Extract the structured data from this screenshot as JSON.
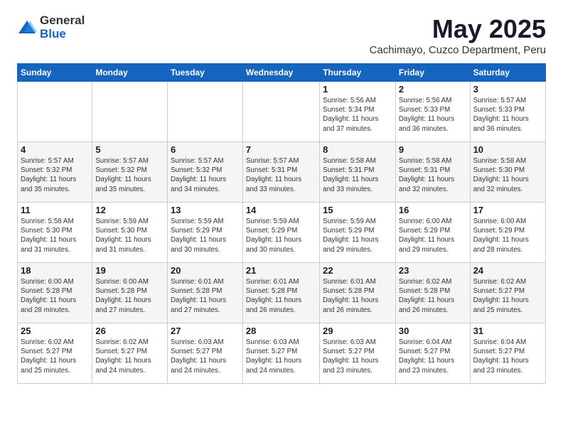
{
  "logo": {
    "general": "General",
    "blue": "Blue"
  },
  "title": "May 2025",
  "subtitle": "Cachimayo, Cuzco Department, Peru",
  "days_of_week": [
    "Sunday",
    "Monday",
    "Tuesday",
    "Wednesday",
    "Thursday",
    "Friday",
    "Saturday"
  ],
  "weeks": [
    [
      {
        "day": "",
        "info": ""
      },
      {
        "day": "",
        "info": ""
      },
      {
        "day": "",
        "info": ""
      },
      {
        "day": "",
        "info": ""
      },
      {
        "day": "1",
        "info": "Sunrise: 5:56 AM\nSunset: 5:34 PM\nDaylight: 11 hours\nand 37 minutes."
      },
      {
        "day": "2",
        "info": "Sunrise: 5:56 AM\nSunset: 5:33 PM\nDaylight: 11 hours\nand 36 minutes."
      },
      {
        "day": "3",
        "info": "Sunrise: 5:57 AM\nSunset: 5:33 PM\nDaylight: 11 hours\nand 36 minutes."
      }
    ],
    [
      {
        "day": "4",
        "info": "Sunrise: 5:57 AM\nSunset: 5:32 PM\nDaylight: 11 hours\nand 35 minutes."
      },
      {
        "day": "5",
        "info": "Sunrise: 5:57 AM\nSunset: 5:32 PM\nDaylight: 11 hours\nand 35 minutes."
      },
      {
        "day": "6",
        "info": "Sunrise: 5:57 AM\nSunset: 5:32 PM\nDaylight: 11 hours\nand 34 minutes."
      },
      {
        "day": "7",
        "info": "Sunrise: 5:57 AM\nSunset: 5:31 PM\nDaylight: 11 hours\nand 33 minutes."
      },
      {
        "day": "8",
        "info": "Sunrise: 5:58 AM\nSunset: 5:31 PM\nDaylight: 11 hours\nand 33 minutes."
      },
      {
        "day": "9",
        "info": "Sunrise: 5:58 AM\nSunset: 5:31 PM\nDaylight: 11 hours\nand 32 minutes."
      },
      {
        "day": "10",
        "info": "Sunrise: 5:58 AM\nSunset: 5:30 PM\nDaylight: 11 hours\nand 32 minutes."
      }
    ],
    [
      {
        "day": "11",
        "info": "Sunrise: 5:58 AM\nSunset: 5:30 PM\nDaylight: 11 hours\nand 31 minutes."
      },
      {
        "day": "12",
        "info": "Sunrise: 5:59 AM\nSunset: 5:30 PM\nDaylight: 11 hours\nand 31 minutes."
      },
      {
        "day": "13",
        "info": "Sunrise: 5:59 AM\nSunset: 5:29 PM\nDaylight: 11 hours\nand 30 minutes."
      },
      {
        "day": "14",
        "info": "Sunrise: 5:59 AM\nSunset: 5:29 PM\nDaylight: 11 hours\nand 30 minutes."
      },
      {
        "day": "15",
        "info": "Sunrise: 5:59 AM\nSunset: 5:29 PM\nDaylight: 11 hours\nand 29 minutes."
      },
      {
        "day": "16",
        "info": "Sunrise: 6:00 AM\nSunset: 5:29 PM\nDaylight: 11 hours\nand 29 minutes."
      },
      {
        "day": "17",
        "info": "Sunrise: 6:00 AM\nSunset: 5:29 PM\nDaylight: 11 hours\nand 28 minutes."
      }
    ],
    [
      {
        "day": "18",
        "info": "Sunrise: 6:00 AM\nSunset: 5:28 PM\nDaylight: 11 hours\nand 28 minutes."
      },
      {
        "day": "19",
        "info": "Sunrise: 6:00 AM\nSunset: 5:28 PM\nDaylight: 11 hours\nand 27 minutes."
      },
      {
        "day": "20",
        "info": "Sunrise: 6:01 AM\nSunset: 5:28 PM\nDaylight: 11 hours\nand 27 minutes."
      },
      {
        "day": "21",
        "info": "Sunrise: 6:01 AM\nSunset: 5:28 PM\nDaylight: 11 hours\nand 26 minutes."
      },
      {
        "day": "22",
        "info": "Sunrise: 6:01 AM\nSunset: 5:28 PM\nDaylight: 11 hours\nand 26 minutes."
      },
      {
        "day": "23",
        "info": "Sunrise: 6:02 AM\nSunset: 5:28 PM\nDaylight: 11 hours\nand 26 minutes."
      },
      {
        "day": "24",
        "info": "Sunrise: 6:02 AM\nSunset: 5:27 PM\nDaylight: 11 hours\nand 25 minutes."
      }
    ],
    [
      {
        "day": "25",
        "info": "Sunrise: 6:02 AM\nSunset: 5:27 PM\nDaylight: 11 hours\nand 25 minutes."
      },
      {
        "day": "26",
        "info": "Sunrise: 6:02 AM\nSunset: 5:27 PM\nDaylight: 11 hours\nand 24 minutes."
      },
      {
        "day": "27",
        "info": "Sunrise: 6:03 AM\nSunset: 5:27 PM\nDaylight: 11 hours\nand 24 minutes."
      },
      {
        "day": "28",
        "info": "Sunrise: 6:03 AM\nSunset: 5:27 PM\nDaylight: 11 hours\nand 24 minutes."
      },
      {
        "day": "29",
        "info": "Sunrise: 6:03 AM\nSunset: 5:27 PM\nDaylight: 11 hours\nand 23 minutes."
      },
      {
        "day": "30",
        "info": "Sunrise: 6:04 AM\nSunset: 5:27 PM\nDaylight: 11 hours\nand 23 minutes."
      },
      {
        "day": "31",
        "info": "Sunrise: 6:04 AM\nSunset: 5:27 PM\nDaylight: 11 hours\nand 23 minutes."
      }
    ]
  ]
}
